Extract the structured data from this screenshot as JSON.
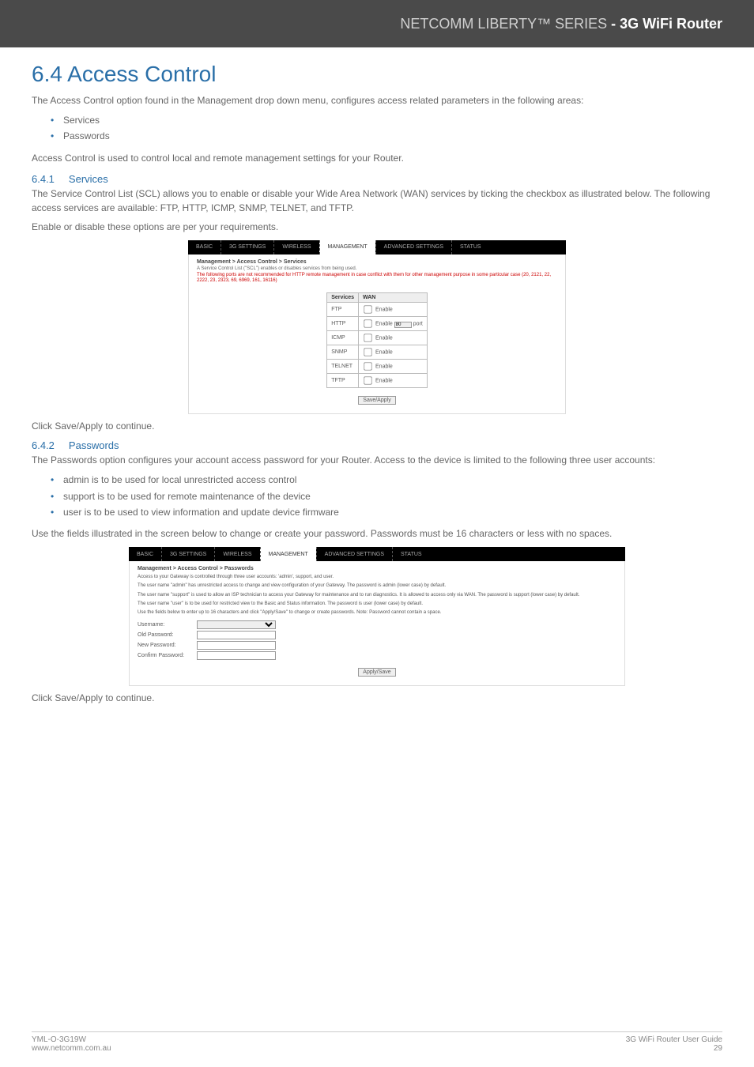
{
  "header": {
    "brand_left": "NETCOMM LIBERTY™ SERIES",
    "brand_right": "- 3G WiFi Router"
  },
  "title": "6.4 Access Control",
  "intro": "The Access Control option found in the Management drop down menu, configures access related parameters in the following areas:",
  "intro_bullets": [
    "Services",
    "Passwords"
  ],
  "intro2": "Access Control is used to control local and remote management settings for your Router.",
  "s641": {
    "num": "6.4.1",
    "name": "Services",
    "p1": "The Service Control List (SCL) allows you to enable or disable your Wide Area Network (WAN) services by ticking the checkbox as illustrated below. The following access services are available: FTP, HTTP, ICMP, SNMP, TELNET, and TFTP.",
    "p2": "Enable or disable these options are per your requirements."
  },
  "shot1": {
    "tabs": [
      "BASIC",
      "3G SETTINGS",
      "WIRELESS",
      "MANAGEMENT",
      "ADVANCED SETTINGS",
      "STATUS"
    ],
    "active_tab_index": 3,
    "crumb": "Management > Access Control > Services",
    "note_black": "A Service Control List (\"SCL\") enables or disables services from being used.",
    "note_red": "The following ports are not recommended for HTTP remote management in case conflict with them for other management purpose in some particular case (20, 2121, 22, 2222, 23, 2323, 69, 6969, 161, 16116)",
    "th_services": "Services",
    "th_wan": "WAN",
    "rows": [
      {
        "name": "FTP",
        "label": "Enable"
      },
      {
        "name": "HTTP",
        "label": "Enable",
        "port": "80",
        "port_label": "port"
      },
      {
        "name": "ICMP",
        "label": "Enable"
      },
      {
        "name": "SNMP",
        "label": "Enable"
      },
      {
        "name": "TELNET",
        "label": "Enable"
      },
      {
        "name": "TFTP",
        "label": "Enable"
      }
    ],
    "button": "Save/Apply"
  },
  "continue1": "Click Save/Apply to continue.",
  "s642": {
    "num": "6.4.2",
    "name": "Passwords",
    "p1": "The Passwords option configures  your account access password for your Router. Access to the device is limited to the following three user accounts:",
    "bullets": [
      "admin is to be used for local unrestricted  access control",
      "support is to be used for remote maintenance of the device",
      "user is to be used  to view information and update device firmware"
    ],
    "p2": "Use the fields illustrated in the screen below to change or create your password. Passwords must be 16 characters or less with no spaces."
  },
  "shot2": {
    "tabs": [
      "BASIC",
      "3G SETTINGS",
      "WIRELESS",
      "MANAGEMENT",
      "ADVANCED SETTINGS",
      "STATUS"
    ],
    "active_tab_index": 3,
    "crumb": "Management > Access Control > Passwords",
    "p1": "Access to your Gateway is controlled through three user accounts: 'admin', support, and user.",
    "p2": "The user name \"admin\" has unrestricted access to change and view configuration of your Gateway. The password is admin (lower case) by default.",
    "p3": "The user name \"support\" is used to allow an ISP technician to access your Gateway for maintenance and to run diagnostics. It is allowed to access only via WAN. The password is support (lower case) by default.",
    "p4": "The user name \"user\" is to be used for restricted view to the Basic and Status information. The password is user (lower case) by default.",
    "p5": "Use the fields below to enter up to 16 characters and click \"Apply/Save\" to change or create passwords. Note: Password cannot contain a space.",
    "labels": {
      "username": "Username:",
      "old": "Old Password:",
      "new": "New Password:",
      "confirm": "Confirm Password:"
    },
    "button": "Apply/Save"
  },
  "continue2": "Click Save/Apply to continue.",
  "footer": {
    "left1": "YML-O-3G19W",
    "left2": "www.netcomm.com.au",
    "right1": "3G WiFi Router User Guide",
    "right2": "29"
  }
}
